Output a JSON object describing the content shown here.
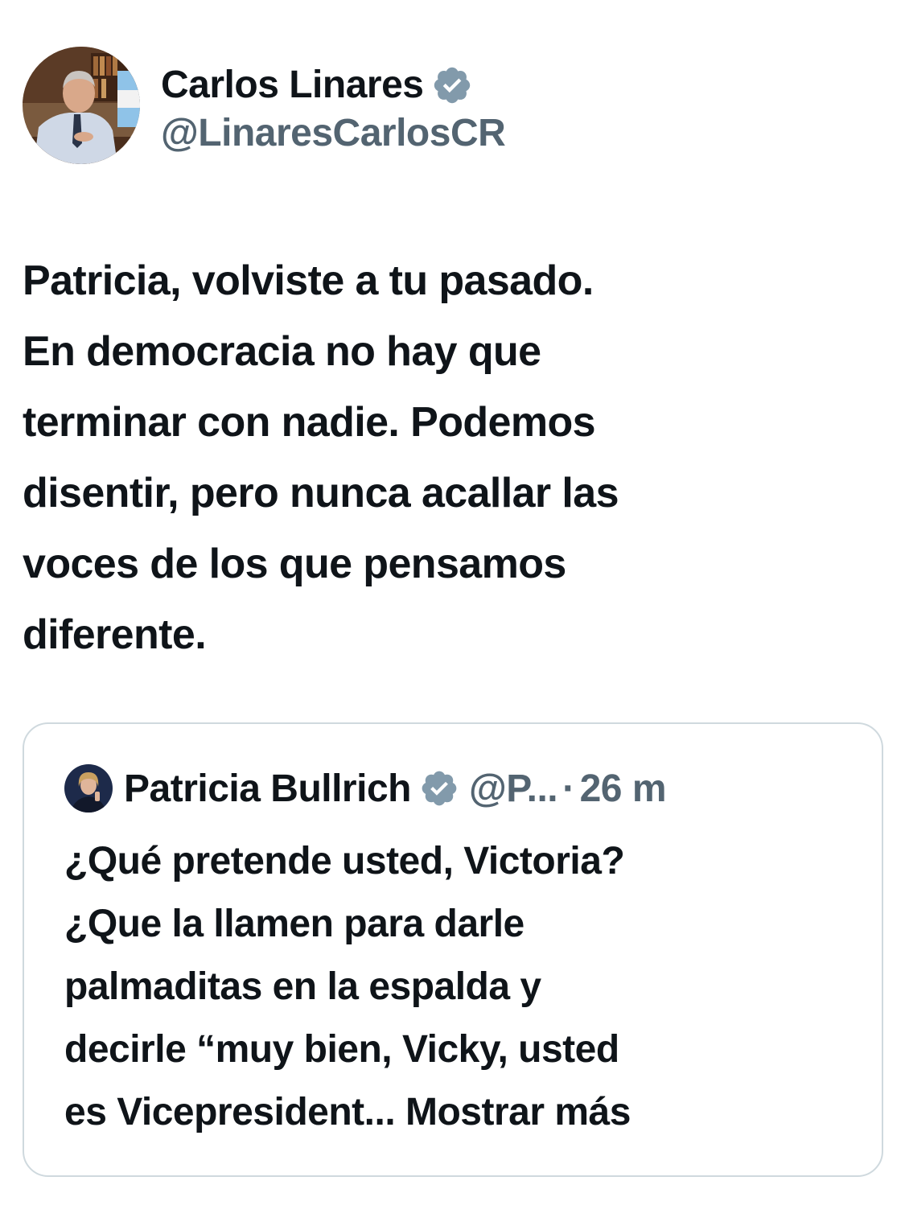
{
  "author": {
    "name": "Carlos Linares",
    "handle": "@LinaresCarlosCR",
    "verified": true
  },
  "tweet": {
    "lines": [
      "Patricia, volviste a tu pasado.",
      "En democracia no hay que",
      "terminar con nadie. Podemos",
      "disentir, pero nunca acallar las",
      "voces de los que pensamos",
      "diferente."
    ]
  },
  "quoted": {
    "name": "Patricia Bullrich",
    "handle": "@P...",
    "separator": "·",
    "time": "26 m",
    "verified": true,
    "lines": [
      "¿Qué pretende usted, Victoria?",
      "¿Que la llamen para darle",
      "palmaditas en la espalda y",
      "decirle “muy bien, Vicky, usted",
      "es Vicepresident..."
    ],
    "show_more_label": "Mostrar más"
  },
  "colors": {
    "text": "#0f1419",
    "secondary": "#536471",
    "border": "#cfd9de",
    "verified_badge": "#829aab"
  },
  "icons": {
    "verified": "verified-badge-icon"
  }
}
